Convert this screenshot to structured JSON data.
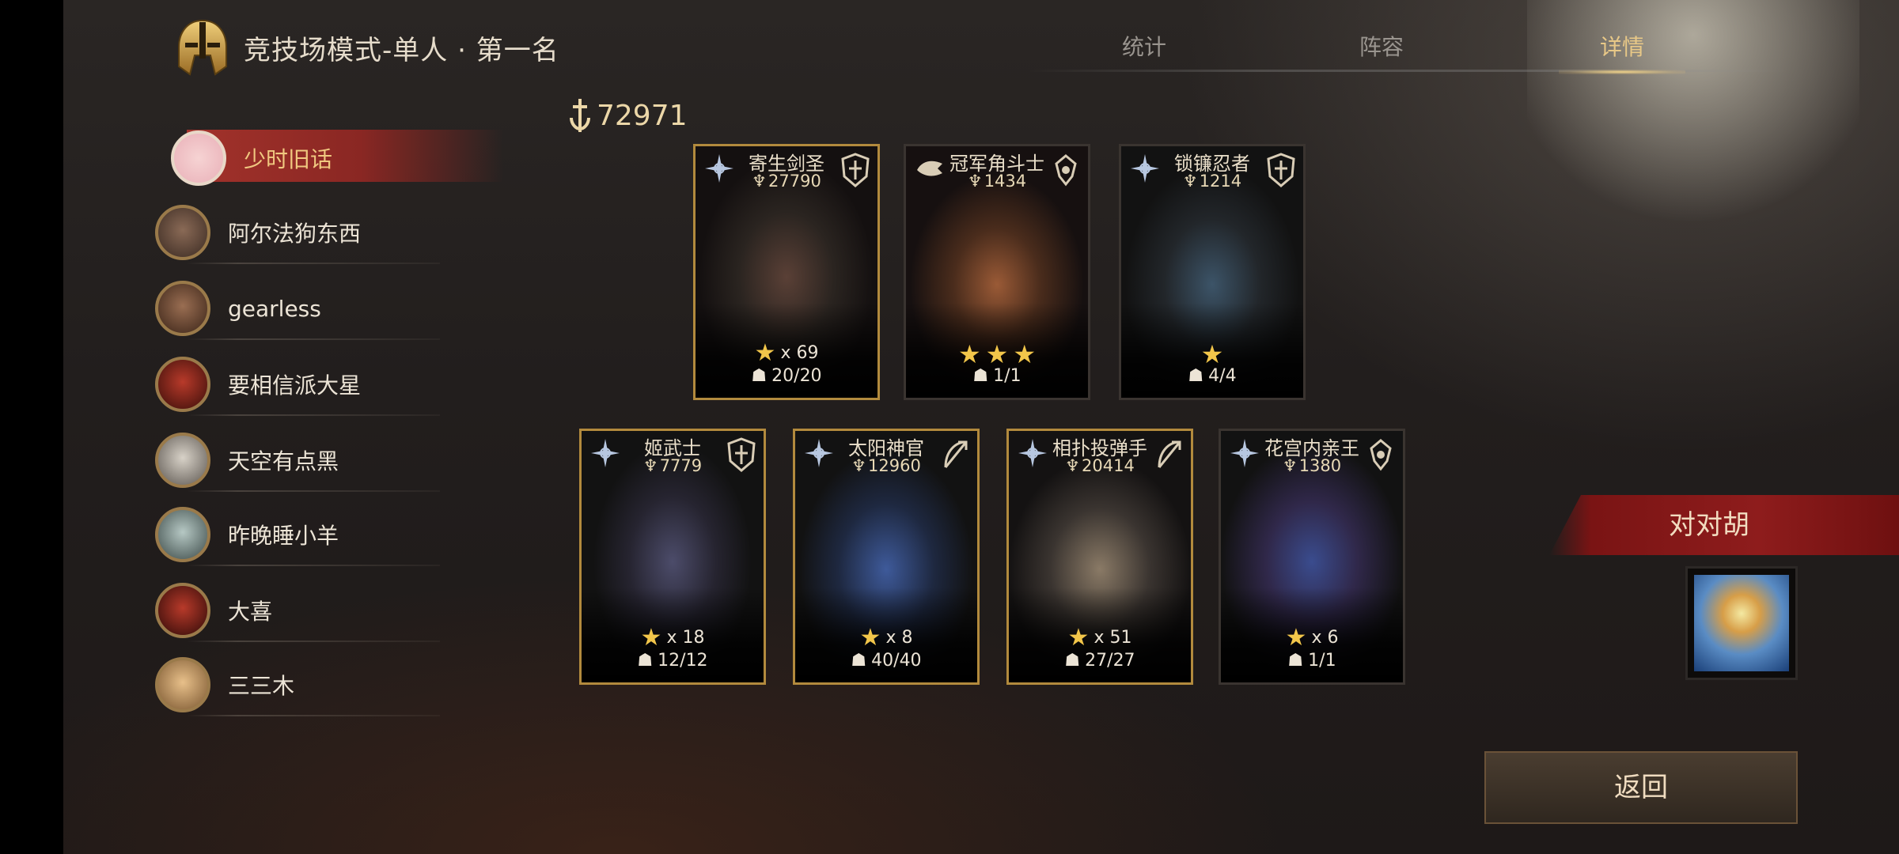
{
  "header": {
    "title": "竞技场模式-单人 · 第一名",
    "tabs": [
      {
        "label": "统计",
        "active": false
      },
      {
        "label": "阵容",
        "active": false
      },
      {
        "label": "详情",
        "active": true
      }
    ]
  },
  "players": [
    {
      "name": "少时旧话",
      "selected": true
    },
    {
      "name": "阿尔法狗东西",
      "selected": false
    },
    {
      "name": "gearless",
      "selected": false
    },
    {
      "name": "要相信派大星",
      "selected": false
    },
    {
      "name": "天空有点黑",
      "selected": false
    },
    {
      "name": "昨晚睡小羊",
      "selected": false
    },
    {
      "name": "大喜",
      "selected": false
    },
    {
      "name": "三三木",
      "selected": false
    }
  ],
  "total_power": "72971",
  "heroes": [
    {
      "name": "寄生剑圣",
      "power": "27790",
      "stars_text": "x 69",
      "star_count": 1,
      "level": "20/20"
    },
    {
      "name": "冠军角斗士",
      "power": "1434",
      "stars_text": "",
      "star_count": 3,
      "level": "1/1"
    },
    {
      "name": "锁镰忍者",
      "power": "1214",
      "stars_text": "",
      "star_count": 1,
      "level": "4/4"
    },
    {
      "name": "姬武士",
      "power": "7779",
      "stars_text": "x 18",
      "star_count": 1,
      "level": "12/12"
    },
    {
      "name": "太阳神官",
      "power": "12960",
      "stars_text": "x 8",
      "star_count": 1,
      "level": "40/40"
    },
    {
      "name": "相扑投弹手",
      "power": "20414",
      "stars_text": "x 51",
      "star_count": 1,
      "level": "27/27"
    },
    {
      "name": "花宫内亲王",
      "power": "1380",
      "stars_text": "x 6",
      "star_count": 1,
      "level": "1/1"
    }
  ],
  "opponent": {
    "name": "对对胡"
  },
  "back_button": {
    "label": "返回"
  },
  "colors": {
    "accent_gold": "#e8c887",
    "banner_red": "#8e1c1c",
    "selected_red": "#a2322b"
  }
}
